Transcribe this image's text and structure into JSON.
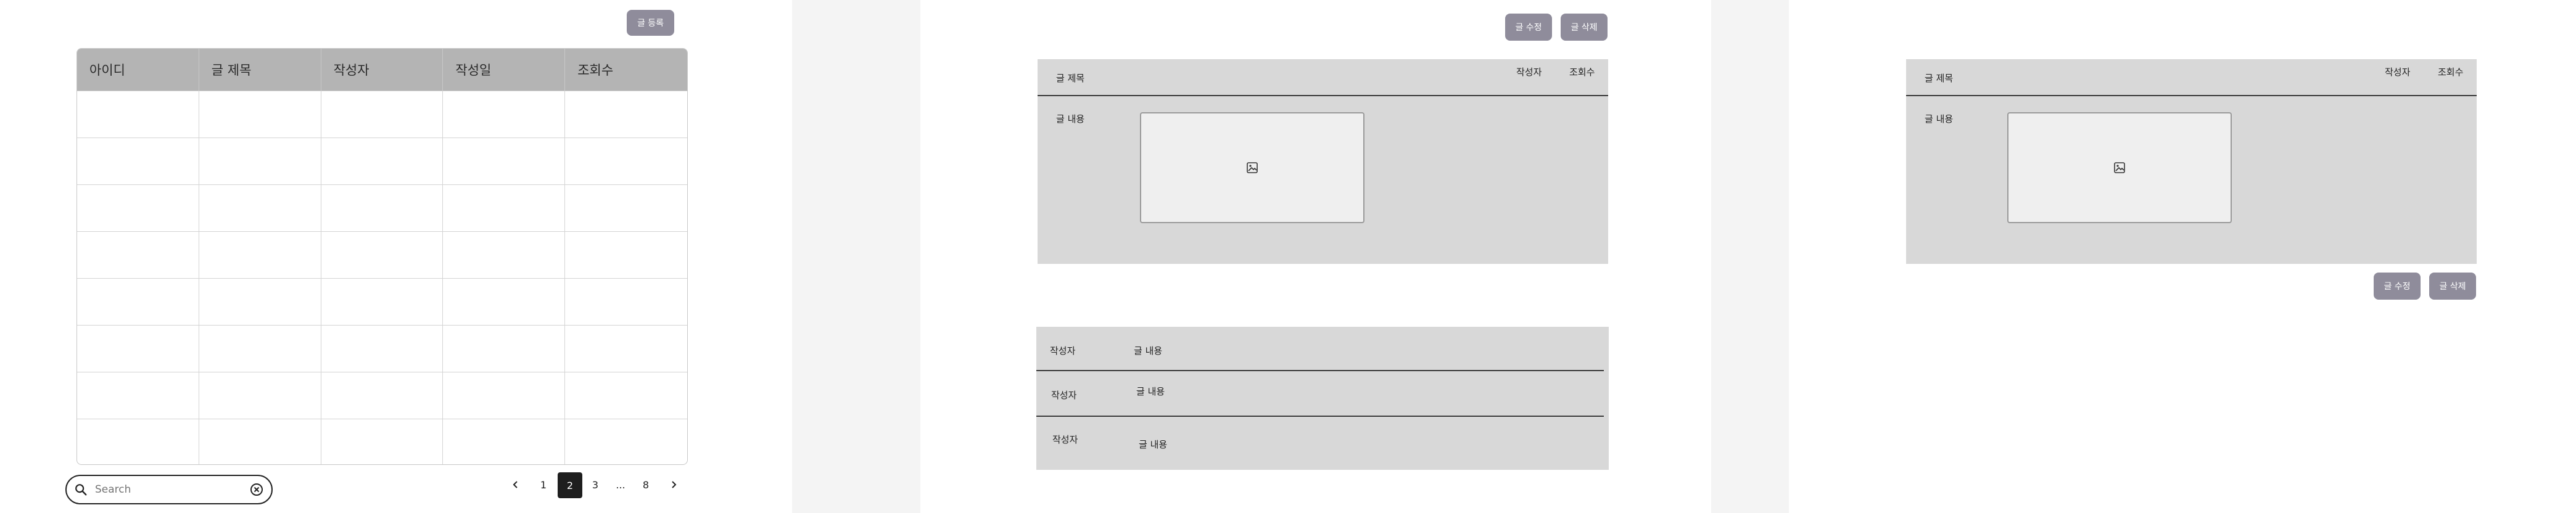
{
  "list_view": {
    "write_button": "글 등록",
    "columns": [
      "아이디",
      "글 제목",
      "작성자",
      "작성일",
      "조회수"
    ],
    "row_count": 8,
    "search": {
      "placeholder": "Search"
    },
    "pagination": {
      "pages": [
        "1",
        "2",
        "3",
        "...",
        "8"
      ],
      "current": "2"
    }
  },
  "detail_view": {
    "edit_button": "글 수정",
    "delete_button": "글 삭제",
    "header": {
      "title_label": "글 제목",
      "author_label": "작성자",
      "views_label": "조회수"
    },
    "content_label": "글 내용",
    "comments": [
      {
        "author": "작성자",
        "content": "글 내용"
      },
      {
        "author": "작성자",
        "content": "글 내용"
      },
      {
        "author": "작성자",
        "content": "글 내용"
      }
    ]
  },
  "detail_view_2": {
    "edit_button": "글 수정",
    "delete_button": "글 삭제",
    "header": {
      "title_label": "글 제목",
      "author_label": "작성자",
      "views_label": "조회수"
    },
    "content_label": "글 내용"
  }
}
